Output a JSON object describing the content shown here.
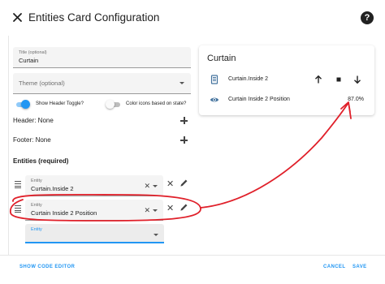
{
  "dialog": {
    "title": "Entities Card Configuration",
    "help_icon": "help-circle-icon"
  },
  "form": {
    "title_field": {
      "label": "Title (optional)",
      "value": "Curtain"
    },
    "theme_field": {
      "placeholder": "Theme (optional)"
    },
    "toggles": [
      {
        "label": "Show Header Toggle?",
        "on": true
      },
      {
        "label": "Color icons based on state?",
        "on": false
      }
    ],
    "header": {
      "label": "Header: None"
    },
    "footer": {
      "label": "Footer: None"
    },
    "entities_title": "Entities (required)",
    "entities": [
      {
        "label": "Entity",
        "value": "Curtain.Inside 2"
      },
      {
        "label": "Entity",
        "value": "Curtain Inside 2 Position"
      }
    ],
    "new_entity": {
      "label": "Entity"
    }
  },
  "preview": {
    "title": "Curtain",
    "rows": [
      {
        "name": "Curtain.Inside 2",
        "icon": "window-shutter-icon",
        "controls": [
          "arrow-up-icon",
          "stop-icon",
          "arrow-down-icon"
        ]
      },
      {
        "name": "Curtain Inside 2 Position",
        "icon": "eye-icon",
        "state": "87.0%"
      }
    ]
  },
  "footer_buttons": {
    "code_editor": "SHOW CODE EDITOR",
    "cancel": "CANCEL",
    "save": "SAVE"
  },
  "colors": {
    "accent": "#2196f3",
    "annotation": "#e0202a"
  }
}
